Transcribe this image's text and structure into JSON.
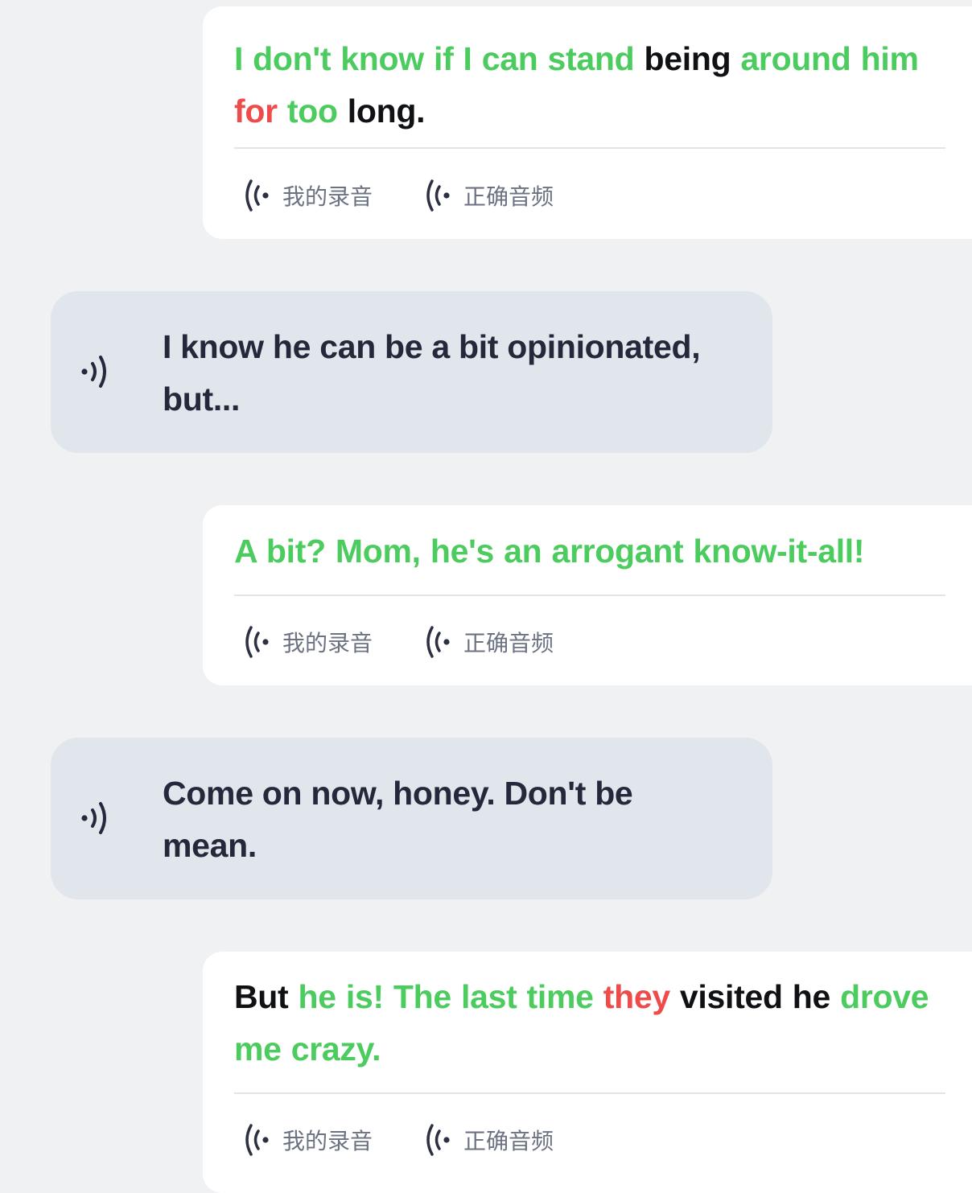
{
  "colors": {
    "correct": "#4ccb5f",
    "incorrect": "#ee4b4b",
    "neutral": "#0f1114",
    "bot_bubble": "#e1e5ec",
    "user_bubble": "#ffffff",
    "background": "#f0f1f3"
  },
  "labels": {
    "my_recording": "我的录音",
    "correct_audio": "正确音频"
  },
  "icons": {
    "recording": "audio-wave-icon",
    "bot_play": "speaker-icon"
  },
  "conversation": [
    {
      "role": "user",
      "words": [
        {
          "t": "I don't know if I can stand",
          "s": "correct"
        },
        {
          "t": "being",
          "s": "neutral"
        },
        {
          "t": "around him",
          "s": "correct"
        },
        {
          "t": "for",
          "s": "incorrect"
        },
        {
          "t": "too",
          "s": "correct"
        },
        {
          "t": "long.",
          "s": "neutral"
        }
      ]
    },
    {
      "role": "bot",
      "text": "I know he can be a bit opinionated, but..."
    },
    {
      "role": "user",
      "words": [
        {
          "t": "A bit? Mom, he's an arrogant know-it-all!",
          "s": "correct"
        }
      ]
    },
    {
      "role": "bot",
      "text": "Come on now, honey. Don't be mean."
    },
    {
      "role": "user",
      "words": [
        {
          "t": "But",
          "s": "neutral"
        },
        {
          "t": "he is! The last time",
          "s": "correct"
        },
        {
          "t": "they",
          "s": "incorrect"
        },
        {
          "t": "visited he",
          "s": "neutral"
        },
        {
          "t": "drove me crazy.",
          "s": "correct"
        }
      ]
    }
  ]
}
